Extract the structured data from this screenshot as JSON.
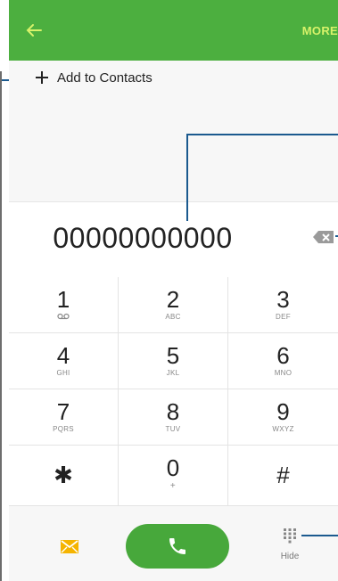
{
  "appbar": {
    "more_label": "MORE"
  },
  "add_contacts": {
    "label": "Add to Contacts"
  },
  "dialer": {
    "number": "00000000000"
  },
  "keypad": {
    "keys": [
      {
        "digit": "1",
        "letters": ""
      },
      {
        "digit": "2",
        "letters": "ABC"
      },
      {
        "digit": "3",
        "letters": "DEF"
      },
      {
        "digit": "4",
        "letters": "GHI"
      },
      {
        "digit": "5",
        "letters": "JKL"
      },
      {
        "digit": "6",
        "letters": "MNO"
      },
      {
        "digit": "7",
        "letters": "PQRS"
      },
      {
        "digit": "8",
        "letters": "TUV"
      },
      {
        "digit": "9",
        "letters": "WXYZ"
      },
      {
        "digit": "✱",
        "letters": ""
      },
      {
        "digit": "0",
        "letters": "+"
      },
      {
        "digit": "#",
        "letters": ""
      }
    ]
  },
  "bottom_bar": {
    "hide_label": "Hide"
  },
  "colors": {
    "accent": "#4caf3f",
    "more_text": "#d8f26a",
    "callout": "#1b5a8f",
    "message_icon": "#f5b400"
  },
  "icons": [
    "back-arrow-icon",
    "plus-icon",
    "backspace-icon",
    "voicemail-icon",
    "message-icon",
    "phone-icon",
    "keypad-grid-icon"
  ]
}
